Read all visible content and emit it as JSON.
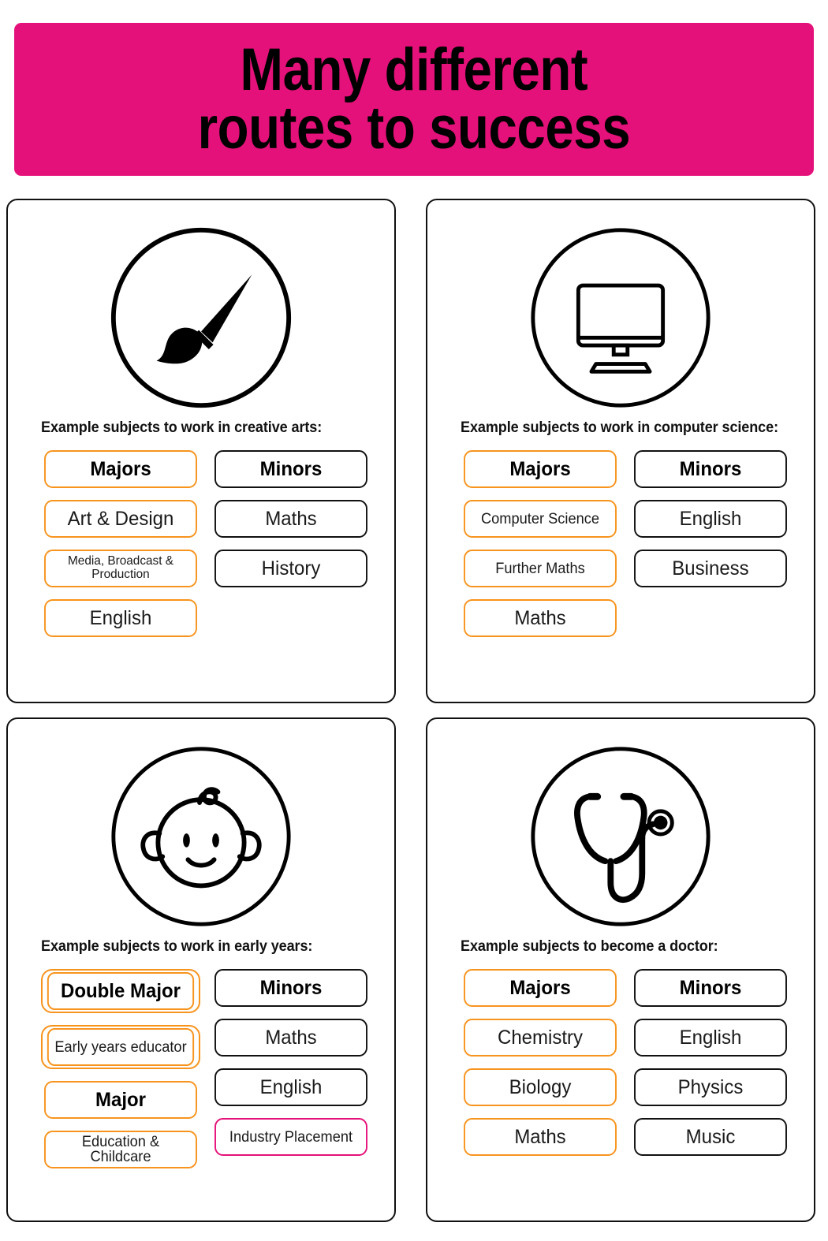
{
  "banner": {
    "title": "Many different\nroutes to success",
    "background_color": "#E5117A",
    "text_color": "#000000"
  },
  "colors": {
    "pink": "#E5117A",
    "orange": "#F7941E",
    "black": "#111111"
  },
  "cards": [
    {
      "icon": "paintbrush-icon",
      "heading": "Example subjects to work in creative arts:",
      "majors": {
        "header": "Majors",
        "items": [
          "Art & Design",
          "Media, Broadcast & Production",
          "English"
        ]
      },
      "minors": {
        "header": "Minors",
        "items": [
          "Maths",
          "History"
        ]
      }
    },
    {
      "icon": "monitor-icon",
      "heading": "Example subjects to work in computer science:",
      "majors": {
        "header": "Majors",
        "items": [
          "Computer Science",
          "Further Maths",
          "Maths"
        ]
      },
      "minors": {
        "header": "Minors",
        "items": [
          "English",
          "Business"
        ]
      }
    },
    {
      "icon": "baby-face-icon",
      "heading": "Example subjects to work in early years:",
      "majors": {
        "header": "Double Major",
        "items": [
          "Early years educator",
          "Major",
          "Education & Childcare"
        ]
      },
      "minors": {
        "header": "Minors",
        "items": [
          "Maths",
          "English",
          "Industry Placement"
        ]
      }
    },
    {
      "icon": "stethoscope-icon",
      "heading": "Example subjects to become a doctor:",
      "majors": {
        "header": "Majors",
        "items": [
          "Chemistry",
          "Biology",
          "Maths"
        ]
      },
      "minors": {
        "header": "Minors",
        "items": [
          "English",
          "Physics",
          "Music"
        ]
      }
    }
  ]
}
